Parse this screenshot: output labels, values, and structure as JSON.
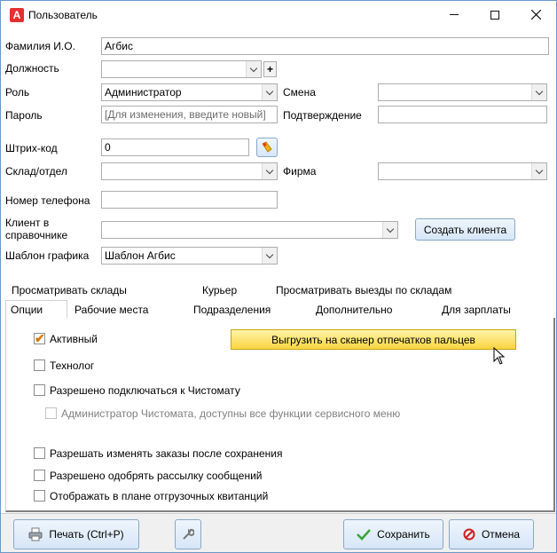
{
  "window": {
    "title": "Пользователь",
    "icon_letter": "A",
    "icon": "app-logo-icon",
    "controls": [
      "minimize-icon",
      "maximize-icon",
      "close-icon"
    ]
  },
  "form": {
    "surname_label": "Фамилия И.О.",
    "surname_value": "Агбис",
    "position_label": "Должность",
    "position_value": "",
    "role_label": "Роль",
    "role_value": "Администратор",
    "shift_label": "Смена",
    "shift_value": "",
    "password_label": "Пароль",
    "password_placeholder": "[Для изменения, введите новый]",
    "confirm_label": "Подтверждение",
    "confirm_value": "",
    "barcode_label": "Штрих-код",
    "barcode_value": "0",
    "warehouse_label": "Склад/отдел",
    "warehouse_value": "",
    "firm_label": "Фирма",
    "firm_value": "",
    "phone_label": "Номер телефона",
    "phone_value": "",
    "client_label_line1": "Клиент в",
    "client_label_line2": "справочнике",
    "client_value": "",
    "create_client_label": "Создать клиента",
    "schedule_label": "Шаблон графика",
    "schedule_value": "Шаблон Агбис",
    "add_symbol": "+"
  },
  "tabs": {
    "row1": [
      "Просматривать склады",
      "Курьер",
      "Просматривать выезды по складам"
    ],
    "row2": [
      "Опции",
      "Рабочие места",
      "Подразделения",
      "Дополнительно",
      "Для зарплаты"
    ],
    "active": "Опции"
  },
  "options": {
    "active_label": "Активный",
    "active_checked": true,
    "technologist_label": "Технолог",
    "connect_label": "Разрешено подключаться к Чистомату",
    "admin_label": "Администратор Чистомата, доступны все функции сервисного меню",
    "edit_orders_label": "Разрешать изменять заказы после сохранения",
    "approve_mailing_label": "Разрешено одобрять рассылку сообщений",
    "show_in_plan_label": "Отображать в плане отгрузочных квитанций",
    "scanner_button_label": "Выгрузить на сканер отпечатков пальцев"
  },
  "footer": {
    "print_label": "Печать (Ctrl+P)",
    "save_label": "Сохранить",
    "cancel_label": "Отмена",
    "icons": [
      "printer-icon",
      "wrench-icon",
      "checkmark-icon",
      "cancel-icon"
    ]
  },
  "colors": {
    "window_border": "#6a97c7",
    "button_gradient_top": "#eef5fd",
    "button_gradient_bottom": "#d6e6f7",
    "scanner_button": "#f9d541",
    "checkmark": "#d97800",
    "save_check": "#3aa43a",
    "cancel_red": "#d02020"
  }
}
